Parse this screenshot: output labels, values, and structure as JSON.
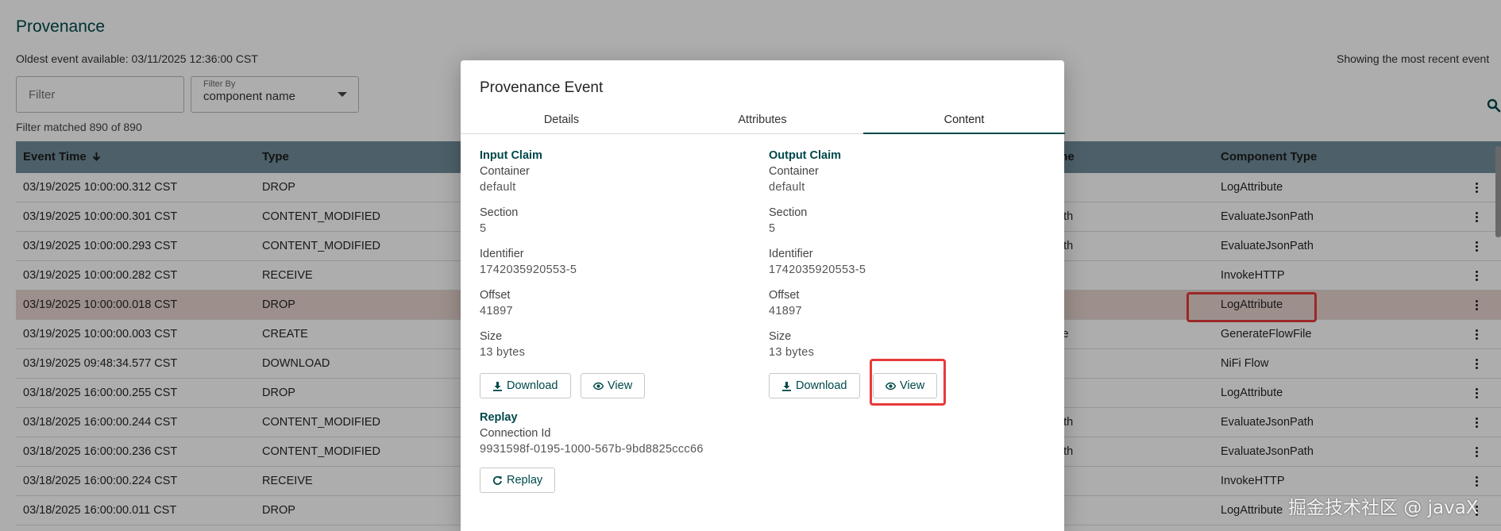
{
  "page": {
    "title": "Provenance",
    "oldest_label": "Oldest event available: 03/11/2025 12:36:00 CST",
    "showing_label": "Showing the most recent event",
    "filter_placeholder": "Filter",
    "filter_by_label": "Filter By",
    "filter_by_value": "component name",
    "matched_label": "Filter matched 890 of 890"
  },
  "table": {
    "headers": {
      "event_time": "Event Time",
      "type": "Type",
      "component_name_partial": "me",
      "component_type": "Component Type"
    },
    "rows": [
      {
        "time": "03/19/2025 10:00:00.312 CST",
        "type": "DROP",
        "name": "",
        "ctype": "LogAttribute"
      },
      {
        "time": "03/19/2025 10:00:00.301 CST",
        "type": "CONTENT_MODIFIED",
        "name": "ath",
        "ctype": "EvaluateJsonPath"
      },
      {
        "time": "03/19/2025 10:00:00.293 CST",
        "type": "CONTENT_MODIFIED",
        "name": "ath",
        "ctype": "EvaluateJsonPath"
      },
      {
        "time": "03/19/2025 10:00:00.282 CST",
        "type": "RECEIVE",
        "name": "",
        "ctype": "InvokeHTTP"
      },
      {
        "time": "03/19/2025 10:00:00.018 CST",
        "type": "DROP",
        "name": "",
        "ctype": "LogAttribute"
      },
      {
        "time": "03/19/2025 10:00:00.003 CST",
        "type": "CREATE",
        "name": "ile",
        "ctype": "GenerateFlowFile"
      },
      {
        "time": "03/19/2025 09:48:34.577 CST",
        "type": "DOWNLOAD",
        "name": "",
        "ctype": "NiFi Flow"
      },
      {
        "time": "03/18/2025 16:00:00.255 CST",
        "type": "DROP",
        "name": "",
        "ctype": "LogAttribute"
      },
      {
        "time": "03/18/2025 16:00:00.244 CST",
        "type": "CONTENT_MODIFIED",
        "name": "ath",
        "ctype": "EvaluateJsonPath"
      },
      {
        "time": "03/18/2025 16:00:00.236 CST",
        "type": "CONTENT_MODIFIED",
        "name": "ath",
        "ctype": "EvaluateJsonPath"
      },
      {
        "time": "03/18/2025 16:00:00.224 CST",
        "type": "RECEIVE",
        "name": "",
        "ctype": "InvokeHTTP"
      },
      {
        "time": "03/18/2025 16:00:00.011 CST",
        "type": "DROP",
        "name": "",
        "ctype": "LogAttribute"
      }
    ]
  },
  "dialog": {
    "title": "Provenance Event",
    "tabs": [
      "Details",
      "Attributes",
      "Content"
    ],
    "input": {
      "heading": "Input Claim",
      "container_label": "Container",
      "container": "default",
      "section_label": "Section",
      "section": "5",
      "identifier_label": "Identifier",
      "identifier": "1742035920553-5",
      "offset_label": "Offset",
      "offset": "41897",
      "size_label": "Size",
      "size": "13 bytes",
      "download_label": "Download",
      "view_label": "View"
    },
    "output": {
      "heading": "Output Claim",
      "container_label": "Container",
      "container": "default",
      "section_label": "Section",
      "section": "5",
      "identifier_label": "Identifier",
      "identifier": "1742035920553-5",
      "offset_label": "Offset",
      "offset": "41897",
      "size_label": "Size",
      "size": "13 bytes",
      "download_label": "Download",
      "view_label": "View"
    },
    "replay": {
      "heading": "Replay",
      "connection_label": "Connection Id",
      "connection_id": "9931598f-0195-1000-567b-9bd8825ccc66",
      "button_label": "Replay"
    }
  },
  "watermark": "掘金技术社区 @ javaX",
  "colors": {
    "accent": "#004849",
    "header_bg": "#728e9b",
    "highlight": "#e83a3a",
    "selected_row": "#e8d4cf"
  }
}
